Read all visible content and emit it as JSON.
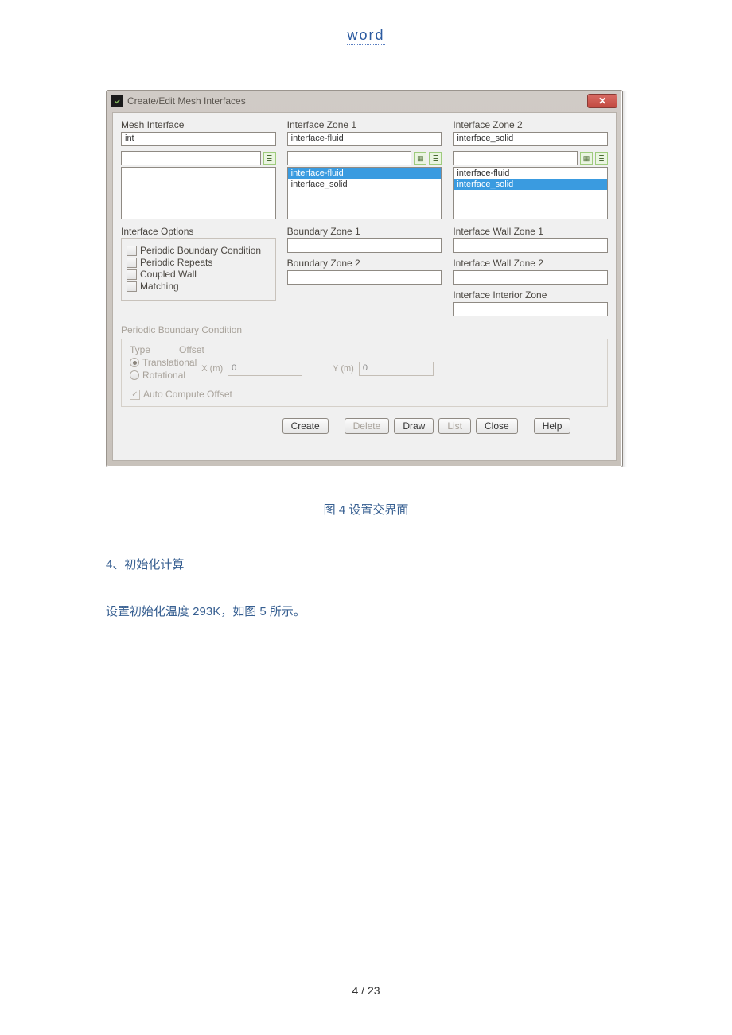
{
  "doc": {
    "header": "word",
    "caption": "图 4 设置交界面",
    "heading": "4、初始化计算",
    "bodytext": "设置初始化温度 293K，如图 5 所示。",
    "page": "4 / 23"
  },
  "dialog": {
    "title": "Create/Edit Mesh Interfaces",
    "labels": {
      "meshInterface": "Mesh Interface",
      "ifZone1": "Interface Zone 1",
      "ifZone2": "Interface Zone 2",
      "ifOptions": "Interface Options",
      "bZone1": "Boundary Zone 1",
      "bZone2": "Boundary Zone 2",
      "ifWall1": "Interface Wall Zone 1",
      "ifWall2": "Interface Wall Zone 2",
      "ifInterior": "Interface Interior Zone",
      "pbcSection": "Periodic Boundary Condition",
      "type": "Type",
      "offset": "Offset",
      "translational": "Translational",
      "rotational": "Rotational",
      "xlabel": "X (m)",
      "ylabel": "Y (m)",
      "auto": "Auto Compute Offset"
    },
    "values": {
      "meshInterface": "int",
      "ifZone1": "interface-fluid",
      "ifZone2": "interface_solid",
      "x": "0",
      "y": "0"
    },
    "options": {
      "pbc": "Periodic Boundary Condition",
      "periodicRepeats": "Periodic Repeats",
      "coupledWall": "Coupled Wall",
      "matching": "Matching"
    },
    "list1": {
      "item0": "interface-fluid",
      "item1": "interface_solid"
    },
    "list2": {
      "item0": "interface-fluid",
      "item1": "interface_solid"
    },
    "buttons": {
      "create": "Create",
      "delete": "Delete",
      "draw": "Draw",
      "list": "List",
      "close": "Close",
      "help": "Help"
    }
  }
}
